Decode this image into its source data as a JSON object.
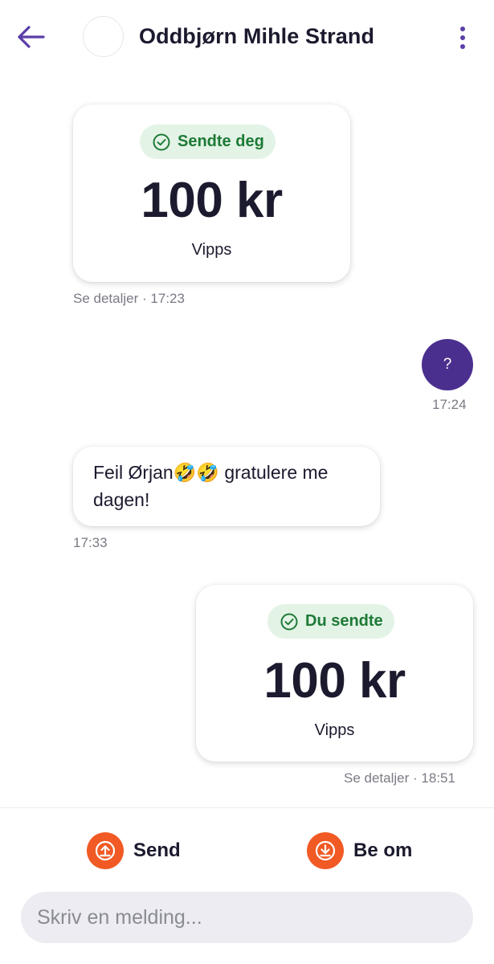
{
  "header": {
    "contact_name": "Oddbjørn Mihle Strand",
    "back_icon": "arrow-left-icon",
    "more_icon": "more-vertical-icon",
    "accent_color": "#5a3ea8"
  },
  "messages": [
    {
      "type": "payment",
      "direction": "incoming",
      "status_label": "Sendte deg",
      "amount": "100 kr",
      "provider": "Vipps",
      "details_label": "Se detaljer",
      "time": "17:23"
    },
    {
      "type": "text",
      "direction": "outgoing",
      "text": "?",
      "time": "17:24"
    },
    {
      "type": "text",
      "direction": "incoming",
      "text_line1": "Feil Ørjan🤣🤣 gratulere me",
      "text_line2": "dagen!",
      "time": "17:33"
    },
    {
      "type": "payment",
      "direction": "outgoing",
      "status_label": "Du sendte",
      "amount": "100 kr",
      "provider": "Vipps",
      "details_label": "Se detaljer",
      "time": "18:51"
    }
  ],
  "meta_separator": "·",
  "actions": {
    "send_label": "Send",
    "request_label": "Be om",
    "send_icon": "upload-icon",
    "request_icon": "download-icon",
    "action_color": "#f15a24"
  },
  "composer": {
    "placeholder": "Skriv en melding..."
  },
  "colors": {
    "status_pill_bg": "#e3f3e6",
    "status_pill_text": "#1e7a36",
    "outgoing_bubble": "#4b2f8f"
  }
}
